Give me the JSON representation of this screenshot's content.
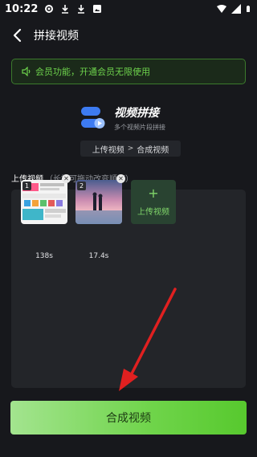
{
  "status_bar": {
    "time": "10:22"
  },
  "app_bar": {
    "title": "拼接视频"
  },
  "notice": {
    "text": "会员功能，开通会员无限使用"
  },
  "feature": {
    "title": "视频拼接",
    "subtitle": "多个视频片段拼接"
  },
  "steps": {
    "step1": "上传视频",
    "separator": ">",
    "step2": "合成视频"
  },
  "upload": {
    "label": "上传视频",
    "hint": "（长按可拖动改变顺序）"
  },
  "clips": [
    {
      "index": "1",
      "duration": "138s"
    },
    {
      "index": "2",
      "duration": "17.4s"
    }
  ],
  "add_button": {
    "plus": "+",
    "label": "上传视频"
  },
  "primary_button": {
    "label": "合成视频"
  },
  "colors": {
    "accent": "#6fd44a",
    "background": "#17181c",
    "arrow": "#e02020"
  }
}
